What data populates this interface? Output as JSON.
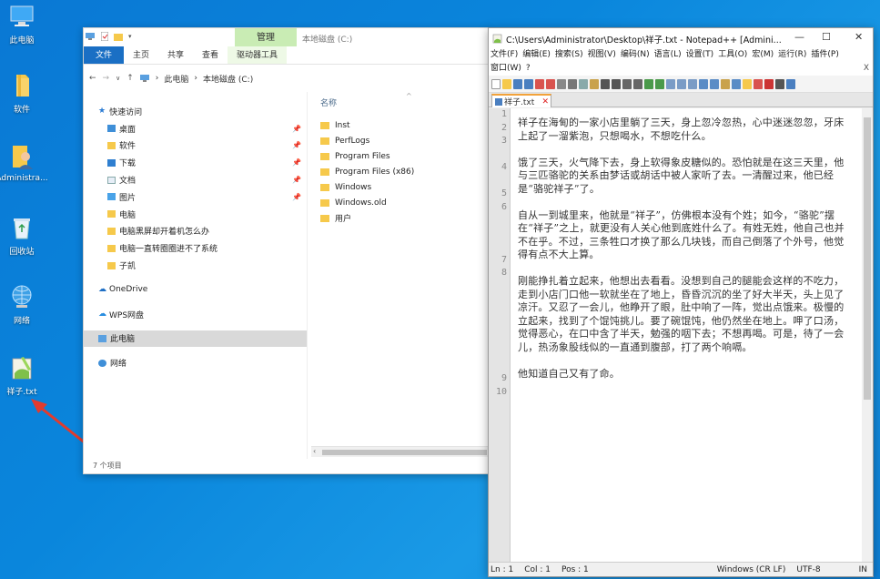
{
  "desktop": {
    "icons": [
      {
        "label": "此电脑"
      },
      {
        "label": "软件"
      },
      {
        "label": "Administra..."
      },
      {
        "label": "回收站"
      },
      {
        "label": "网络"
      },
      {
        "label": "祥子.txt"
      }
    ]
  },
  "explorer": {
    "manage_tab": "管理",
    "title": "本地磁盘 (C:)",
    "ribbon": {
      "file": "文件",
      "home": "主页",
      "share": "共享",
      "view": "查看",
      "drive_tools": "驱动器工具"
    },
    "breadcrumb": [
      "此电脑",
      "本地磁盘 (C:)"
    ],
    "nav": {
      "quick_access": "快速访问",
      "quick_items": [
        "桌面",
        "软件",
        "下载",
        "文档",
        "图片",
        "电脑",
        "电脑黑屏却开着机怎么办",
        "电脑一直转圈圈进不了系统",
        "子凯"
      ],
      "onedrive": "OneDrive",
      "wps": "WPS网盘",
      "this_pc": "此电脑",
      "network": "网络"
    },
    "files_header": "名称",
    "files": [
      "Inst",
      "PerfLogs",
      "Program Files",
      "Program Files (x86)",
      "Windows",
      "Windows.old",
      "用户"
    ],
    "status": "7 个项目"
  },
  "notepad": {
    "title": "C:\\Users\\Administrator\\Desktop\\祥子.txt - Notepad++ [Admini...",
    "menu_row1": [
      "文件(F)",
      "编辑(E)",
      "搜索(S)",
      "视图(V)",
      "编码(N)",
      "语言(L)",
      "设置(T)",
      "工具(O)",
      "宏(M)",
      "运行(R)",
      "插件(P)"
    ],
    "menu_row2": [
      "窗口(W)",
      "?"
    ],
    "menu_close": "X",
    "tab_label": "祥子.txt",
    "line_numbers": [
      "1",
      "2",
      "3",
      "",
      "4",
      "",
      "5",
      "6",
      "",
      "",
      "",
      "7",
      "8",
      "",
      "",
      "",
      "",
      "",
      "",
      "",
      "9",
      "10"
    ],
    "paragraphs": [
      "祥子在海甸的一家小店里躺了三天，身上忽冷忽热，心中迷迷忽忽，牙床上起了一溜紫泡，只想喝水，不想吃什么。",
      "饿了三天，火气降下去，身上软得象皮糖似的。恐怕就是在这三天里，他与三匹骆驼的关系由梦话或胡话中被人家听了去。一清醒过来，他已经是“骆驼祥子”了。",
      "自从一到城里来，他就是“祥子”，仿佛根本没有个姓；如今，“骆驼”摆在“祥子”之上，就更没有人关心他到底姓什么了。有姓无姓，他自己也并不在乎。不过，三条牲口才换了那么几块钱，而自己倒落了个外号，他觉得有点不大上算。",
      "刚能挣扎着立起来，他想出去看看。没想到自己的腿能会这样的不吃力，走到小店门口他一软就坐在了地上，昏昏沉沉的坐了好大半天，头上见了凉汗。又忍了一会儿，他睁开了眼，肚中响了一阵，觉出点饿来。极慢的立起来，找到了个馄饨挑儿。要了碗馄饨，他仍然坐在地上。呷了口汤，觉得恶心，在口中含了半天，勉强的咽下去；不想再喝。可是，待了一会儿，热汤象股线似的一直通到腹部，打了两个响嗝。",
      "他知道自己又有了命。"
    ],
    "status": {
      "ln": "Ln : 1",
      "col": "Col : 1",
      "pos": "Pos : 1",
      "eol": "Windows (CR LF)",
      "enc": "UTF-8",
      "mode": "IN"
    }
  }
}
